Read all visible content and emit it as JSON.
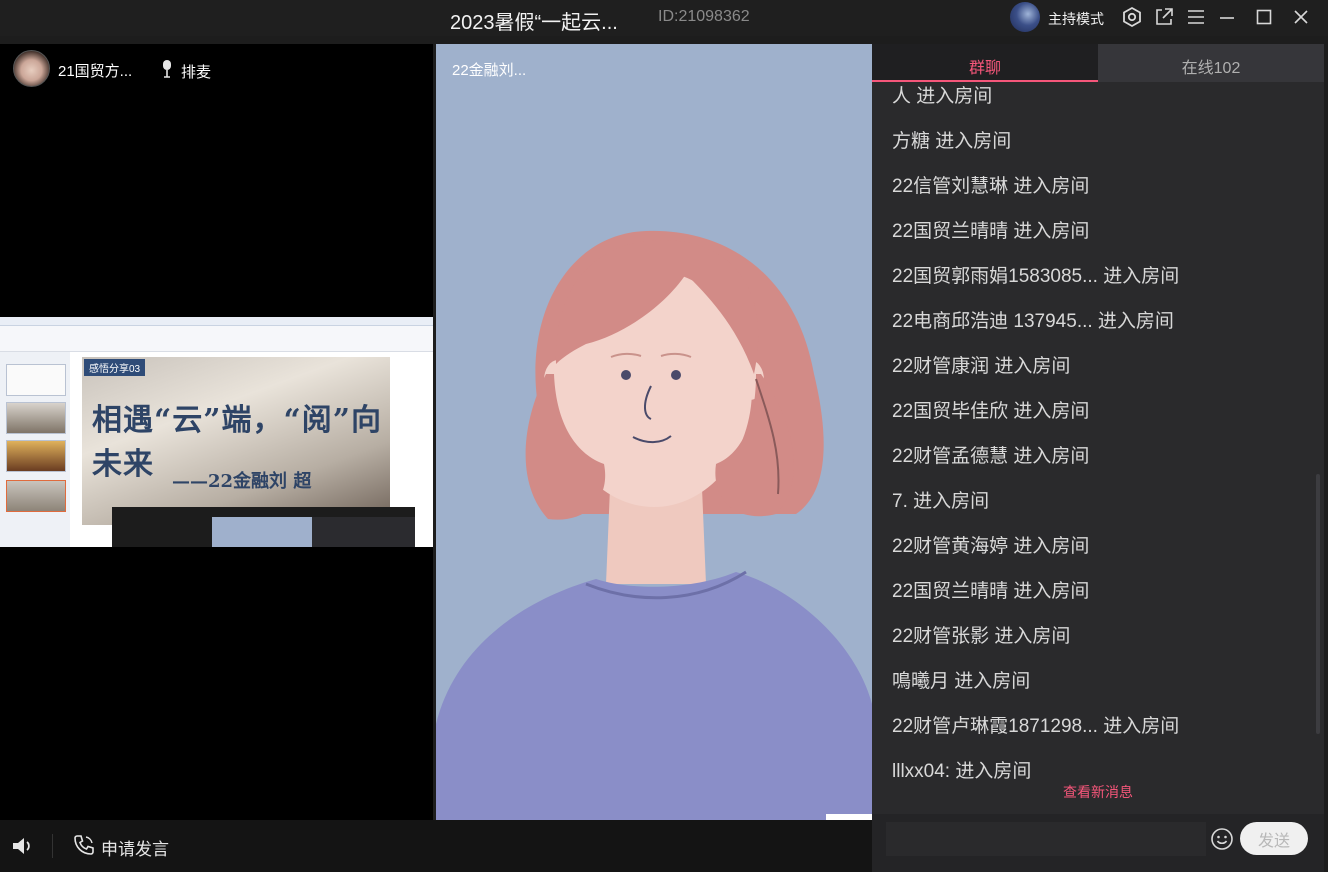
{
  "titlebar": {
    "title": "2023暑假“一起云...",
    "room_id": "ID:21098362",
    "host_mode_label": "主持模式"
  },
  "left_video": {
    "user_name": "21国贸方...",
    "queue_label": "排麦"
  },
  "screen_share": {
    "slide_badge": "感悟分享03",
    "slide_title": "相遇“云”端，“阅”向未来",
    "slide_subtitle": "——22金融刘 超"
  },
  "middle_video": {
    "user_name": "22金融刘..."
  },
  "bottom_bar": {
    "apply_speak_label": "申请发言"
  },
  "chat": {
    "tabs": [
      {
        "label": "群聊",
        "active": true
      },
      {
        "label": "在线102",
        "active": false
      }
    ],
    "messages": [
      "人 进入房间",
      "方糖 进入房间",
      "22信管刘慧琳 进入房间",
      "22国贸兰晴晴 进入房间",
      "22国贸郭雨娟1583085... 进入房间",
      "22电商邱浩迪 137945... 进入房间",
      "22财管康润 进入房间",
      "22国贸毕佳欣 进入房间",
      "22财管孟德慧 进入房间",
      "7. 进入房间",
      "22财管黄海婷 进入房间",
      "22国贸兰晴晴 进入房间",
      "22财管张影 进入房间",
      "鳴曦月 进入房间",
      "22财管卢琳霞1871298... 进入房间",
      "lllxx04: 进入房间"
    ],
    "new_messages_label": "查看新消息",
    "input_value": "",
    "send_label": "发送"
  },
  "colors": {
    "accent": "#f5567a",
    "chat_bg": "#2a2a2c",
    "video_bg": "#9fb1cc"
  },
  "icons": [
    "settings-icon",
    "popout-icon",
    "menu-icon",
    "minimize-icon",
    "maximize-icon",
    "close-icon",
    "mic-icon",
    "speaker-icon",
    "phone-icon",
    "emoji-icon"
  ]
}
